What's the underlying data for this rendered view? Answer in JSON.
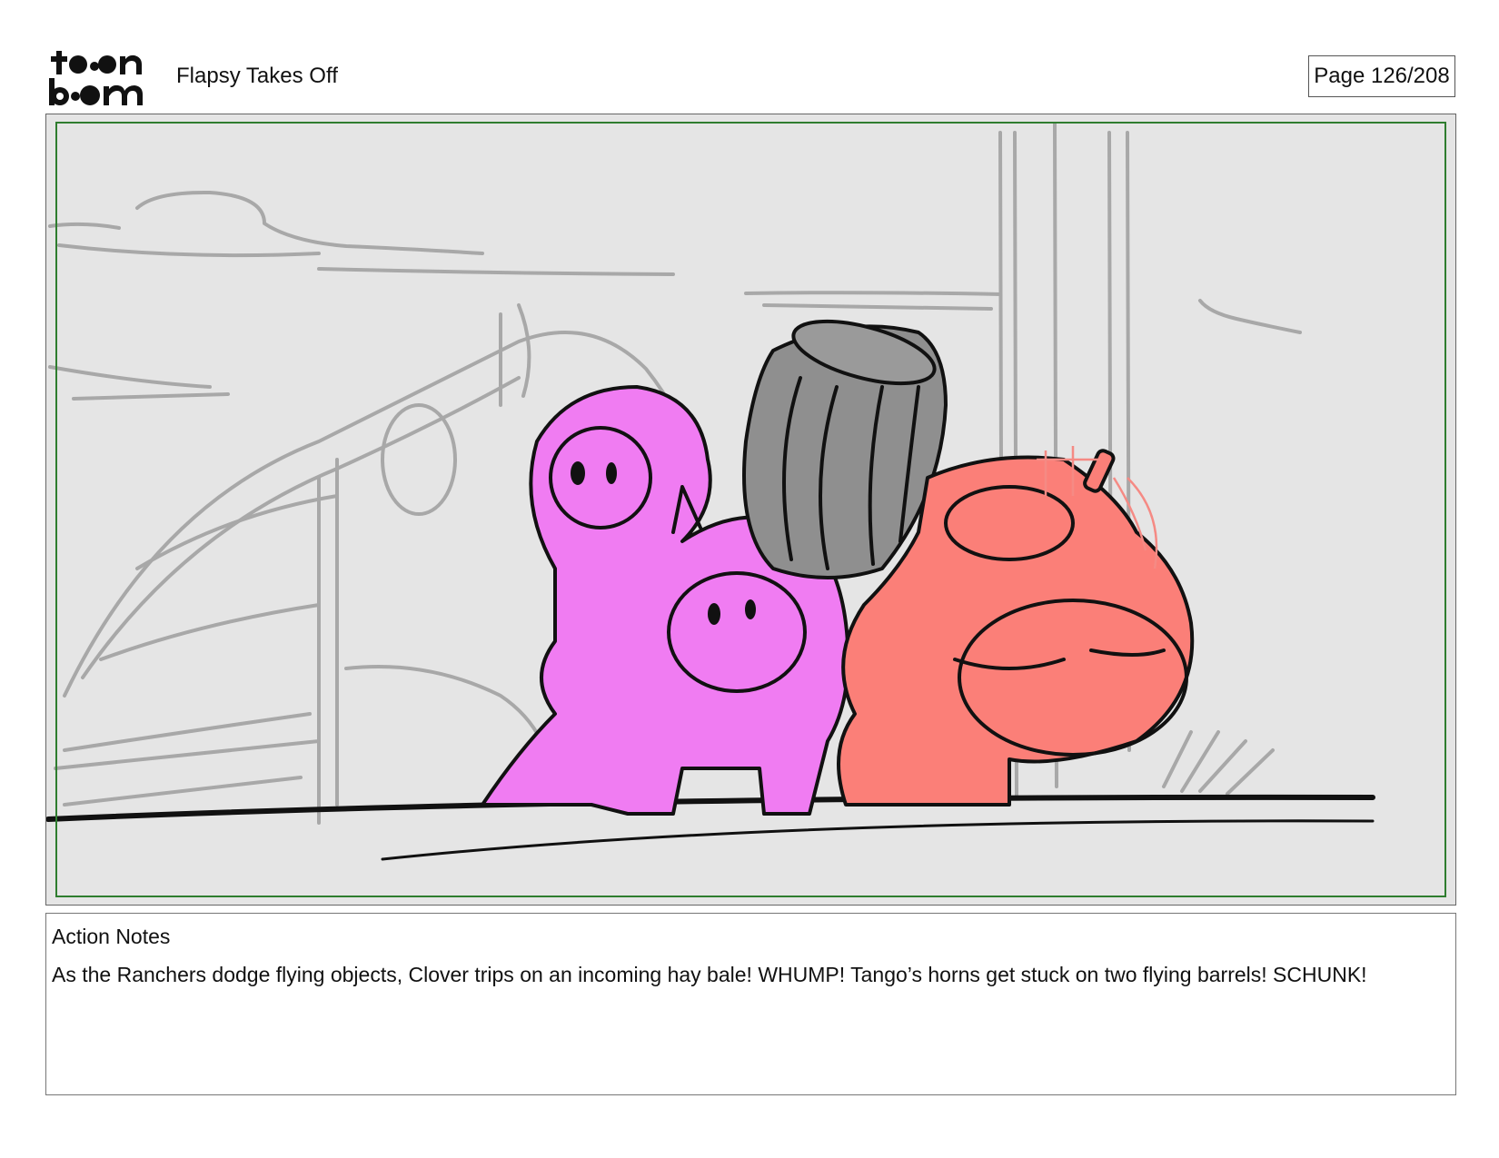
{
  "header": {
    "logo_text": "toon boom",
    "project_title": "Flapsy Takes Off",
    "page_label": "Page 126/208"
  },
  "panel": {
    "colors": {
      "background": "#e5e5e5",
      "sketch_lines": "#a8a8a8",
      "pink_character": "#f07cf2",
      "red_character": "#fb7f78",
      "barrel": "#8f8f8f",
      "ink": "#111111",
      "safe_area_frame": "#2f7d2f"
    }
  },
  "notes": {
    "heading": "Action Notes",
    "text": "As the Ranchers dodge flying objects, Clover trips on an incoming hay bale! WHUMP! Tango’s horns get stuck on two flying barrels! SCHUNK!"
  }
}
